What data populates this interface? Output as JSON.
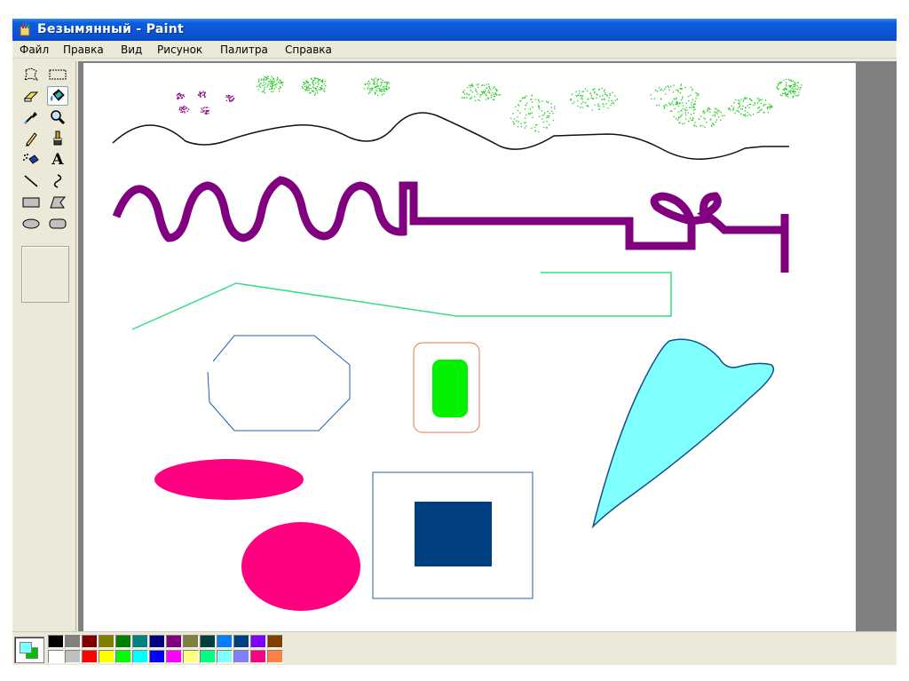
{
  "window": {
    "title": "Безымянный - Paint"
  },
  "menu": {
    "items": [
      "Файл",
      "Правка",
      "Вид",
      "Рисунок",
      "Палитра",
      "Справка"
    ]
  },
  "toolbox": {
    "tools": [
      {
        "name": "free-form-select-icon"
      },
      {
        "name": "rectangle-select-icon"
      },
      {
        "name": "eraser-icon"
      },
      {
        "name": "fill-bucket-icon",
        "selected": true
      },
      {
        "name": "color-picker-icon"
      },
      {
        "name": "magnifier-icon"
      },
      {
        "name": "pencil-icon"
      },
      {
        "name": "brush-icon"
      },
      {
        "name": "airbrush-icon"
      },
      {
        "name": "text-icon",
        "glyph": "A"
      },
      {
        "name": "line-icon"
      },
      {
        "name": "curve-icon"
      },
      {
        "name": "rectangle-icon"
      },
      {
        "name": "polygon-icon"
      },
      {
        "name": "ellipse-icon"
      },
      {
        "name": "rounded-rectangle-icon"
      }
    ]
  },
  "colors": {
    "foreground": "#80ffff",
    "background": "#00c000",
    "palette_top": [
      "#000000",
      "#808080",
      "#800000",
      "#808000",
      "#008000",
      "#008080",
      "#000080",
      "#800080",
      "#808040",
      "#004040",
      "#0080ff",
      "#004080",
      "#8000ff",
      "#804000"
    ],
    "palette_bottom": [
      "#ffffff",
      "#c0c0c0",
      "#ff0000",
      "#ffff00",
      "#00ff00",
      "#00ffff",
      "#0000ff",
      "#ff00ff",
      "#ffff80",
      "#00ff80",
      "#80ffff",
      "#8080ff",
      "#ff0080",
      "#ff8040"
    ]
  },
  "drawing_colors": {
    "spray_purple": "#8b0d8c",
    "spray_green": "#22cc22",
    "black_curve": "#111111",
    "purple_stroke": "#800080",
    "green_line": "#33dd88",
    "octagon": "#1f5fa8",
    "rounded_rect_outline": "#e07a38",
    "rounded_rect_fill": "#00f000",
    "kite_fill": "#80ffff",
    "kite_outline": "#14508c",
    "pink": "#ff0080",
    "square_outline": "#1f5fa8",
    "square_fill": "#004080"
  }
}
